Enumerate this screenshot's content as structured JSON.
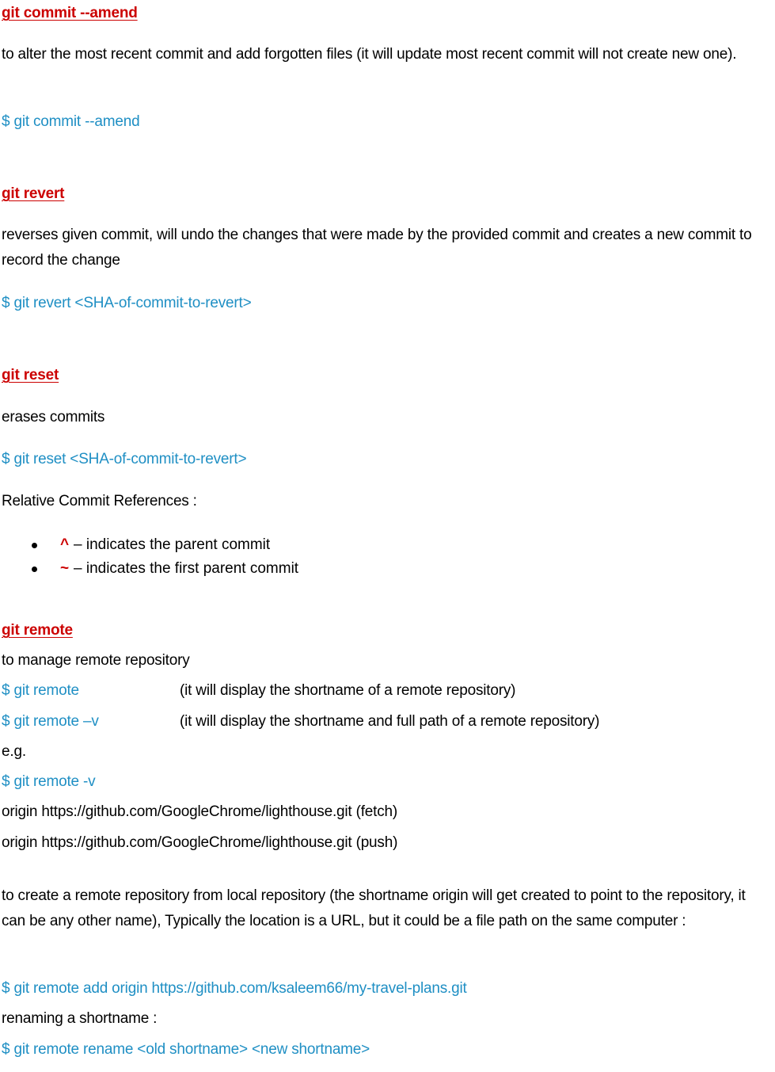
{
  "sections": {
    "amend": {
      "heading": "git commit  --amend",
      "description": "to alter the most recent commit and add forgotten files (it will update most recent commit will not create new one).",
      "command": "$ git commit --amend"
    },
    "revert": {
      "heading": "git revert",
      "description": "reverses given commit, will undo the changes that were made by the provided commit and creates a new commit to record the change",
      "command": "$ git revert <SHA-of-commit-to-revert>"
    },
    "reset": {
      "heading": "git reset",
      "description": "erases commits",
      "command": "$ git reset <SHA-of-commit-to-revert>",
      "relative_label": "Relative Commit References :",
      "bullets": [
        {
          "symbol": "^",
          "text": "– indicates the parent commit"
        },
        {
          "symbol": "~",
          "text": "– indicates the first parent commit"
        }
      ]
    },
    "remote": {
      "heading": "git remote",
      "description": "to manage remote repository",
      "cmd1": "$ git remote",
      "cmd1_desc": "(it will display the shortname of a remote repository)",
      "cmd2": "$ git remote –v",
      "cmd2_desc": "(it will display the shortname and full path of a remote repository)",
      "eg_label": "e.g.",
      "eg_cmd": "$ git remote -v",
      "output1": "origin  https://github.com/GoogleChrome/lighthouse.git (fetch)",
      "output2": "origin  https://github.com/GoogleChrome/lighthouse.git (push)",
      "create_desc": "to create a remote repository from local repository (the shortname origin will get created to point to the repository, it can be any other name), Typically the location is a URL, but it could be a file path on the same computer  :",
      "add_cmd": "$ git remote add origin https://github.com/ksaleem66/my-travel-plans.git",
      "rename_label": "renaming a shortname :",
      "rename_cmd": "$ git remote rename <old shortname> <new shortname>"
    }
  },
  "colors": {
    "heading": "#cc0000",
    "command": "#1f8fc4",
    "text": "#000000"
  }
}
